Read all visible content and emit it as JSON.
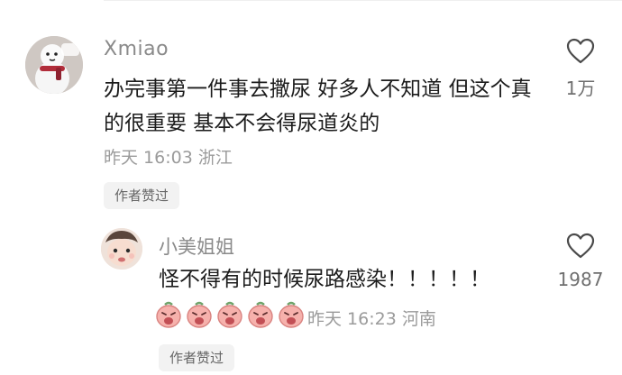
{
  "main_comment": {
    "username": "Xmiao",
    "text": "办完事第一件事去撒尿 好多人不知道 但这个真的很重要 基本不会得尿道炎的",
    "time": "昨天 16:03",
    "location": "浙江",
    "author_liked_label": "作者赞过",
    "like_count": "1万",
    "icons": {
      "like": "heart-outline-icon",
      "avatar": "snowman-avatar"
    }
  },
  "reply": {
    "username": "小美姐姐",
    "text": "怪不得有的时候尿路感染！！！！！",
    "emojis": [
      "peach-emoji",
      "peach-emoji",
      "peach-emoji",
      "peach-emoji",
      "peach-emoji"
    ],
    "time": "昨天 16:23",
    "location": "河南",
    "author_liked_label": "作者赞过",
    "like_count": "1987",
    "icons": {
      "like": "heart-outline-icon",
      "avatar": "baby-face-avatar"
    }
  },
  "colors": {
    "text": "#1c1c1c",
    "meta": "#9b9b9b",
    "username": "#8a8a8a",
    "badge_bg": "#f2f2f2",
    "emoji_peach": "#f4a3a0"
  }
}
